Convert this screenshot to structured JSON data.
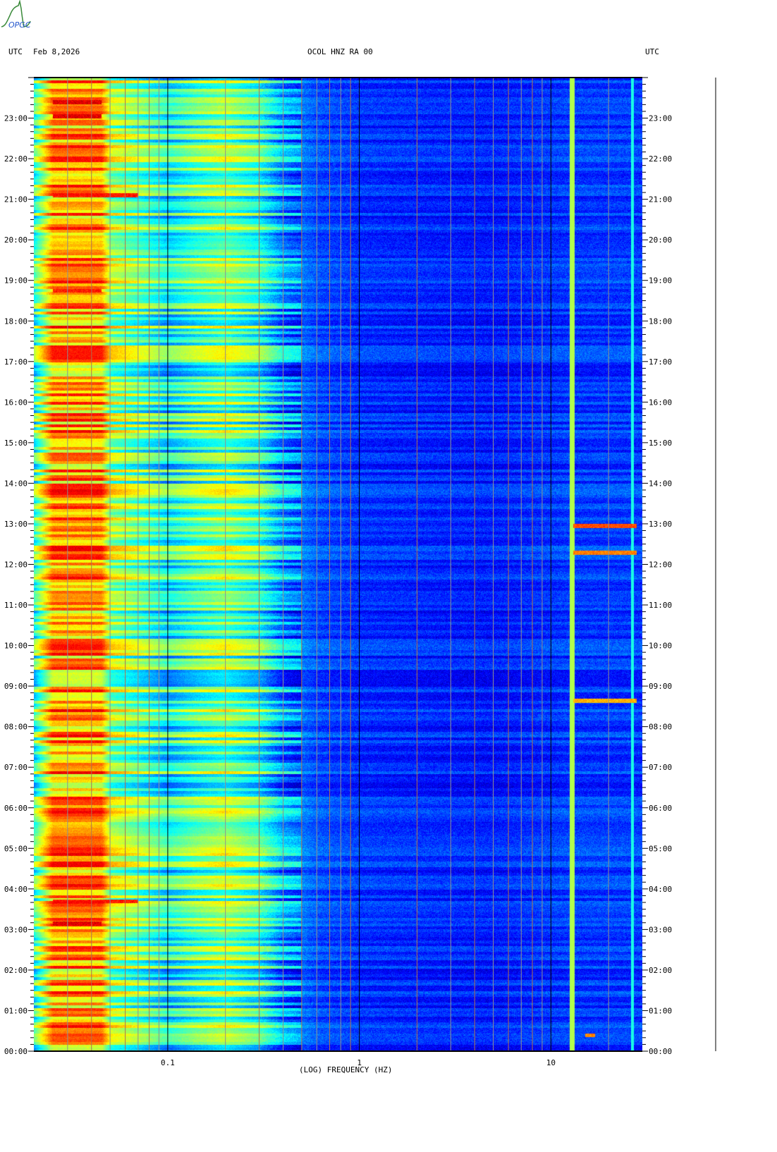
{
  "logo": {
    "text": "OPGC"
  },
  "header": {
    "left_tz": "UTC",
    "date": "Feb 8,2026",
    "station": "OCOL HNZ RA 00",
    "right_tz": "UTC"
  },
  "chart_data": {
    "type": "heatmap",
    "title": "OCOL HNZ RA 00",
    "xlabel": "(LOG) FREQUENCY (HZ)",
    "ylabel": "UTC",
    "x_scale": "log",
    "xlim": [
      0.02,
      30
    ],
    "ylim_hours": [
      0,
      24
    ],
    "x_tick_values": [
      0.1,
      1,
      10
    ],
    "x_tick_labels": [
      "0.1",
      "1",
      "10"
    ],
    "x_grid_values": [
      0.03,
      0.04,
      0.05,
      0.06,
      0.07,
      0.08,
      0.09,
      0.1,
      0.2,
      0.3,
      0.4,
      0.5,
      0.6,
      0.7,
      0.8,
      0.9,
      1,
      2,
      3,
      4,
      5,
      6,
      7,
      8,
      9,
      10,
      20
    ],
    "y_tick_labels": [
      "00:00",
      "01:00",
      "02:00",
      "03:00",
      "04:00",
      "05:00",
      "06:00",
      "07:00",
      "08:00",
      "09:00",
      "10:00",
      "11:00",
      "12:00",
      "13:00",
      "14:00",
      "15:00",
      "16:00",
      "17:00",
      "18:00",
      "19:00",
      "20:00",
      "21:00",
      "22:00",
      "23:00"
    ],
    "minor_ticks_per_hour": 6,
    "colormap": "jet",
    "mean_level_profile": {
      "freq_hz": [
        0.02,
        0.025,
        0.045,
        0.05,
        0.07,
        0.1,
        0.14,
        0.2,
        0.3,
        0.4,
        0.6,
        1,
        5,
        12,
        30
      ],
      "level": [
        0.42,
        0.72,
        0.72,
        0.55,
        0.48,
        0.38,
        0.45,
        0.5,
        0.42,
        0.28,
        0.2,
        0.17,
        0.15,
        0.18,
        0.18
      ]
    },
    "events": [
      {
        "hour": 23.4,
        "freq_band_hz": [
          0.025,
          0.045
        ],
        "level": 0.95
      },
      {
        "hour": 23.05,
        "freq_band_hz": [
          0.025,
          0.045
        ],
        "level": 0.95
      },
      {
        "hour": 21.1,
        "freq_band_hz": [
          0.025,
          0.07
        ],
        "level": 0.9
      },
      {
        "hour": 18.75,
        "freq_band_hz": [
          0.025,
          0.045
        ],
        "level": 0.9
      },
      {
        "hour": 3.15,
        "freq_band_hz": [
          0.025,
          0.045
        ],
        "level": 0.95
      },
      {
        "hour": 3.7,
        "freq_band_hz": [
          0.025,
          0.07
        ],
        "level": 0.9
      },
      {
        "hour": 12.95,
        "freq_band_hz": [
          13,
          28
        ],
        "level": 0.85
      },
      {
        "hour": 12.3,
        "freq_band_hz": [
          13,
          28
        ],
        "level": 0.8
      },
      {
        "hour": 8.65,
        "freq_band_hz": [
          13,
          28
        ],
        "level": 0.75
      },
      {
        "hour": 0.4,
        "freq_band_hz": [
          15,
          17
        ],
        "level": 0.8
      }
    ]
  }
}
